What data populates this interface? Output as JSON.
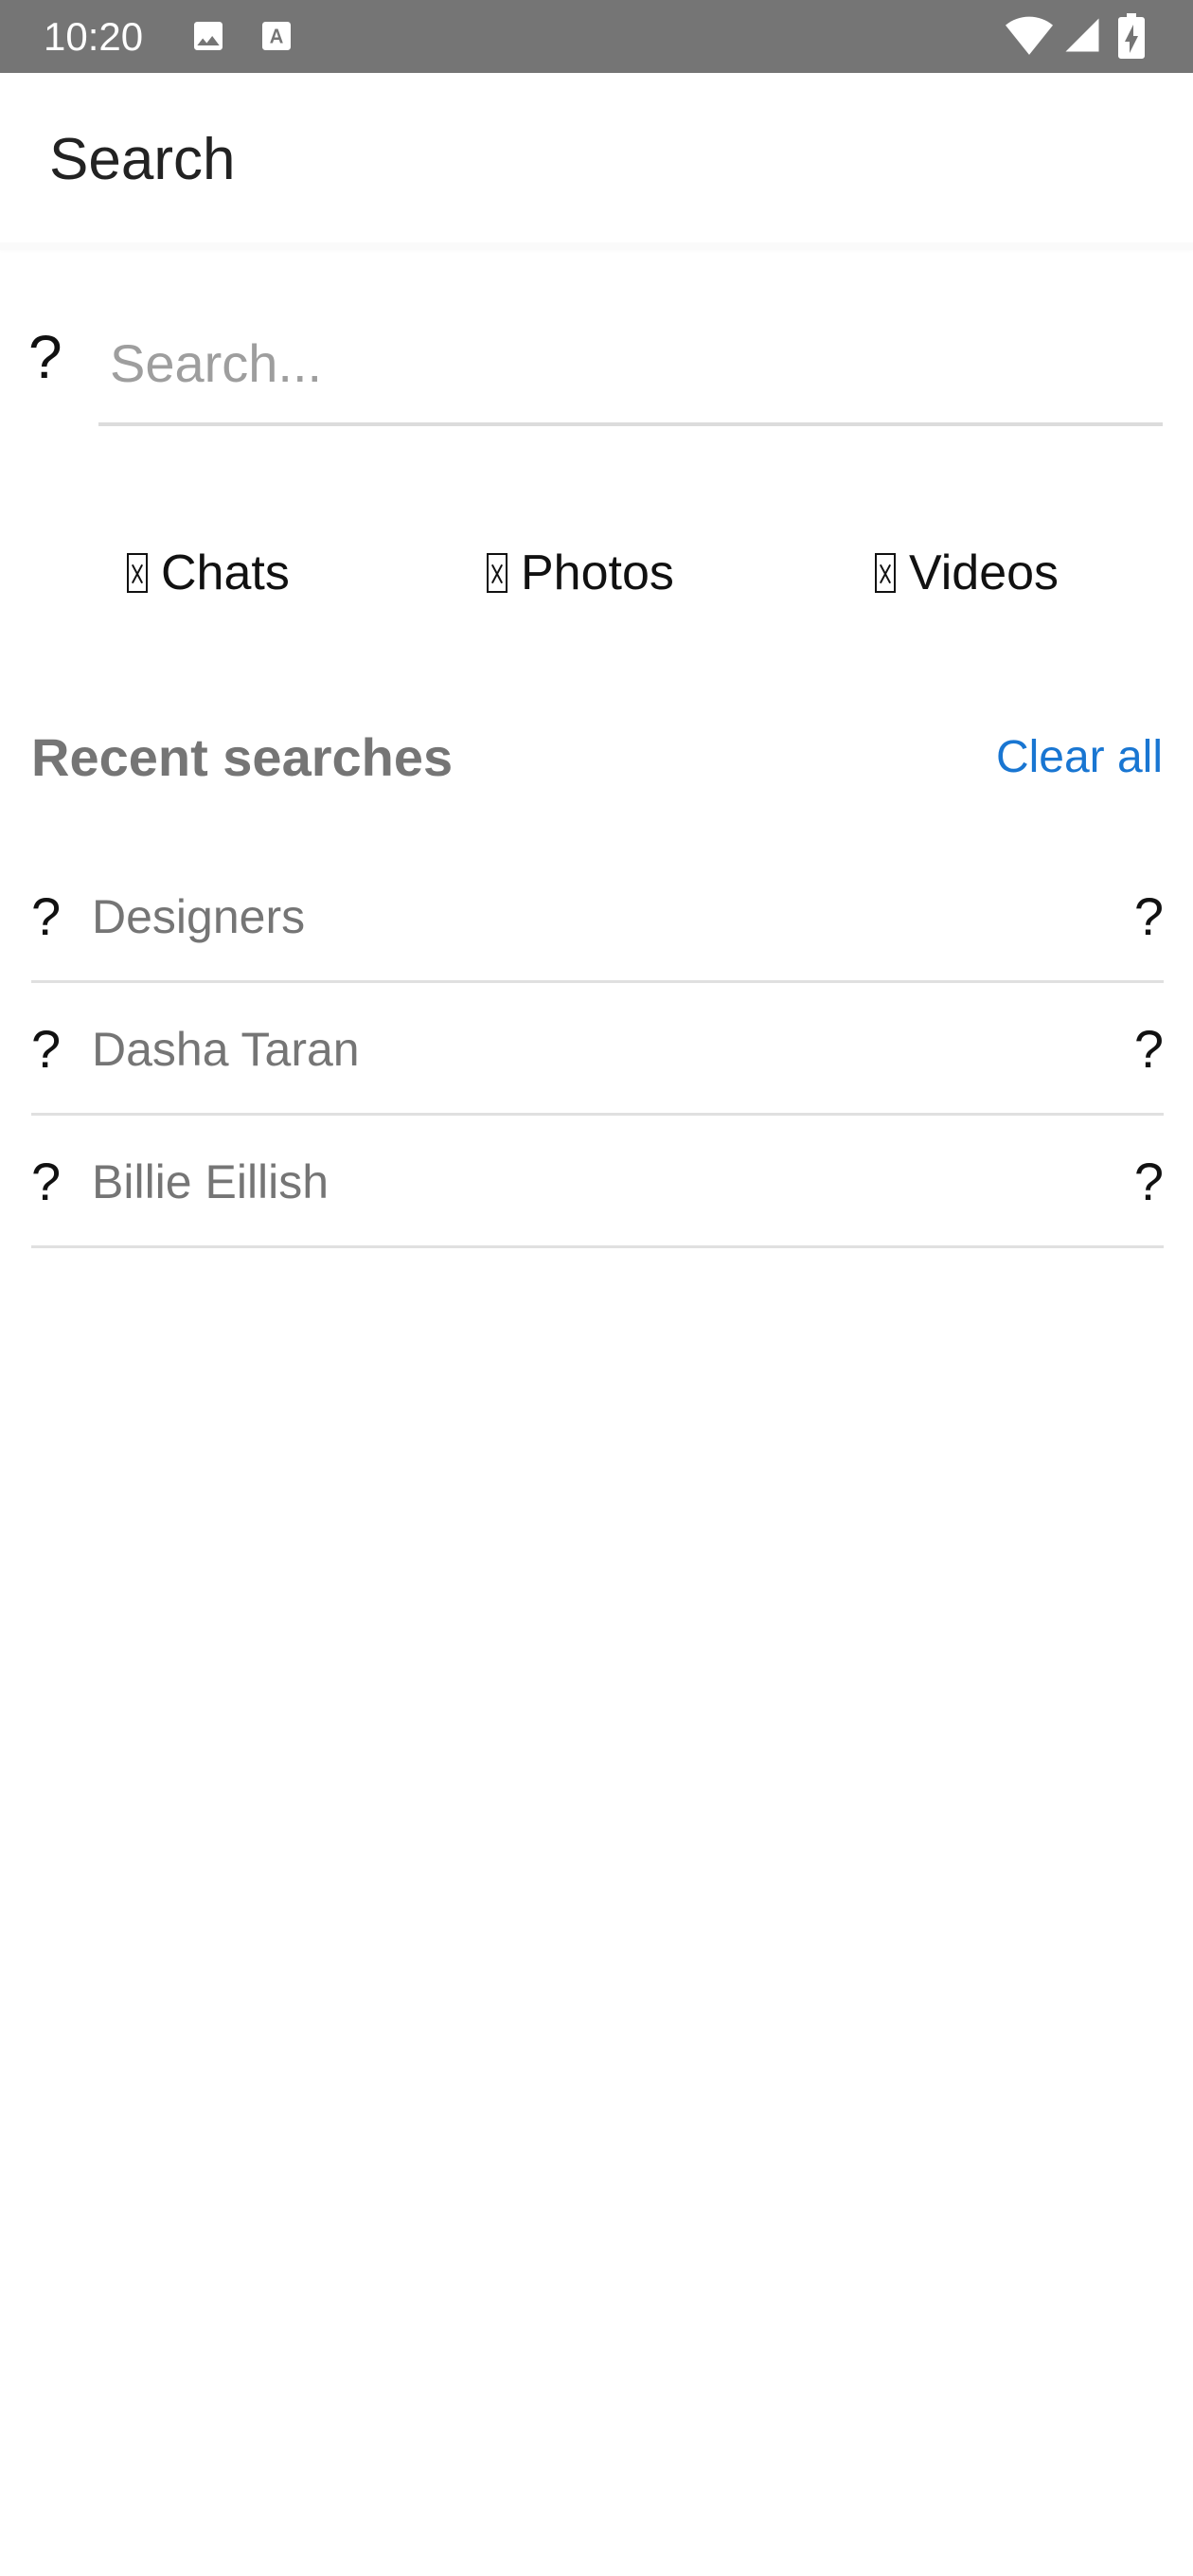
{
  "status_bar": {
    "time": "10:20",
    "icons": [
      "image-icon",
      "font-icon",
      "wifi-icon",
      "signal-icon",
      "battery-charging-icon"
    ]
  },
  "app_bar": {
    "title": "Search"
  },
  "search": {
    "icon_glyph": "?",
    "icon": "search-icon",
    "placeholder": "Search...",
    "value": ""
  },
  "tabs": [
    {
      "label": "Chats",
      "icon": "chat-icon"
    },
    {
      "label": "Photos",
      "icon": "photo-icon"
    },
    {
      "label": "Videos",
      "icon": "video-icon"
    }
  ],
  "recent": {
    "title": "Recent searches",
    "clear_label": "Clear all",
    "accent_color": "#1976d2",
    "items": [
      {
        "label": "Designers",
        "icon_glyph": "?",
        "remove_glyph": "?"
      },
      {
        "label": "Dasha Taran",
        "icon_glyph": "?",
        "remove_glyph": "?"
      },
      {
        "label": "Billie Eillish",
        "icon_glyph": "?",
        "remove_glyph": "?"
      }
    ]
  }
}
